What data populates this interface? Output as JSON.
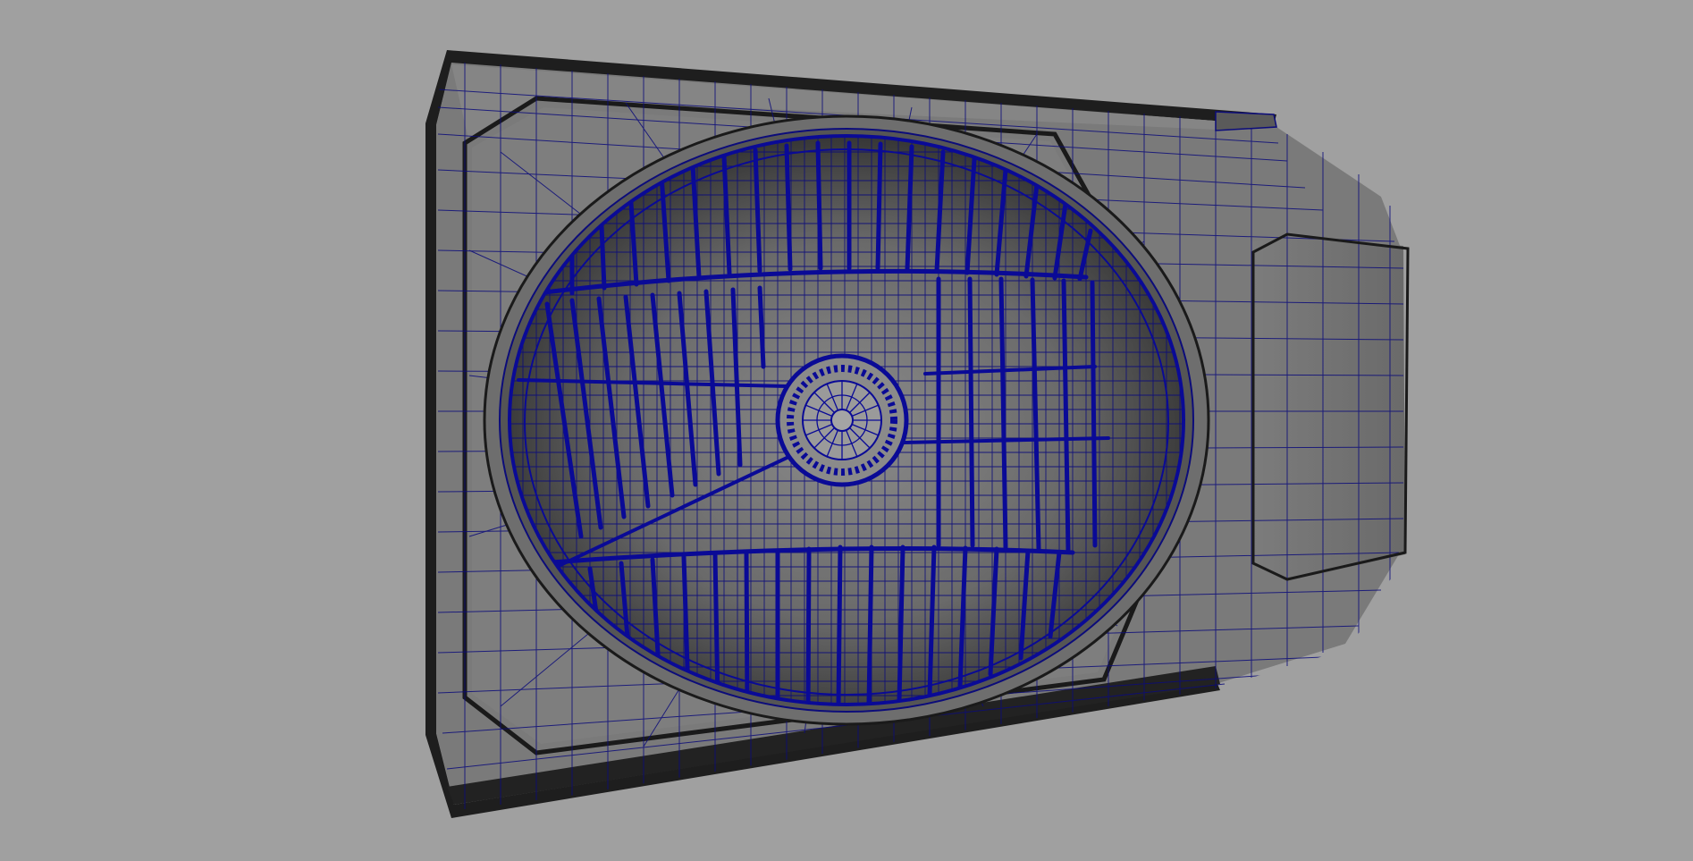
{
  "viewport": {
    "background_color": "#a0a0a0",
    "mesh_fill_color": "#7a7a7a",
    "mesh_dark_color": "#262626",
    "wire_color": "#0c0c7a",
    "selected_wire_color": "#0a0a96"
  },
  "scene": {
    "objects": [
      {
        "name": "headlight-housing",
        "display": "wireframe-on-shaded"
      },
      {
        "name": "headlight-reflector",
        "display": "wireframe-on-shaded",
        "selected": true
      }
    ]
  }
}
